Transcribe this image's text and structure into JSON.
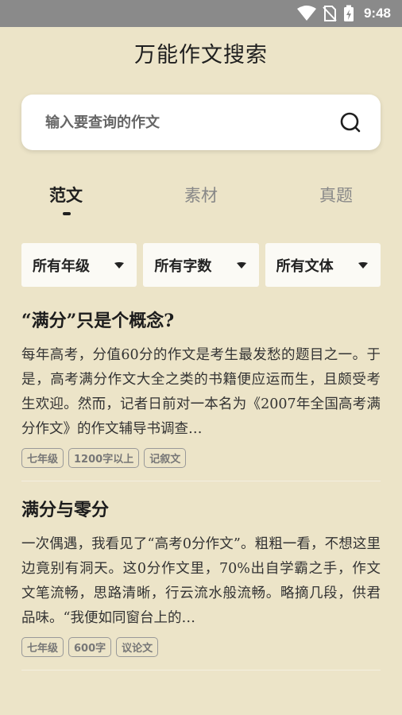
{
  "status_bar": {
    "time": "9:48",
    "icons": [
      "wifi-icon",
      "no-sim-icon",
      "battery-charging-icon"
    ]
  },
  "app": {
    "title": "万能作文搜索"
  },
  "search": {
    "placeholder": "输入要查询的作文"
  },
  "tabs": [
    {
      "label": "范文",
      "active": true
    },
    {
      "label": "素材",
      "active": false
    },
    {
      "label": "真题",
      "active": false
    }
  ],
  "filters": [
    {
      "label": "所有年级"
    },
    {
      "label": "所有字数"
    },
    {
      "label": "所有文体"
    }
  ],
  "articles": [
    {
      "title": "“满分”只是个概念?",
      "excerpt": "每年高考，分值60分的作文是考生最发愁的题目之一。于是，高考满分作文大全之类的书籍便应运而生，且颇受考生欢迎。然而，记者日前对一本名为《2007年全国高考满分作文》的作文辅导书调查…",
      "tags": [
        "七年级",
        "1200字以上",
        "记叙文"
      ]
    },
    {
      "title": "满分与零分",
      "excerpt": "一次偶遇，我看见了“高考0分作文”。粗粗一看，不想这里边竟别有洞天。这0分作文里，70%出自学霸之手，作文文笔流畅，思路清晰，行云流水般流畅。略摘几段，供君品味。“我便如同窗台上的…",
      "tags": [
        "七年级",
        "600字",
        "议论文"
      ]
    }
  ],
  "colors": {
    "background": "#ece4c8",
    "status_bar": "#8a8a8a",
    "card": "#ffffff",
    "filter_bg": "#fbfaf5"
  }
}
